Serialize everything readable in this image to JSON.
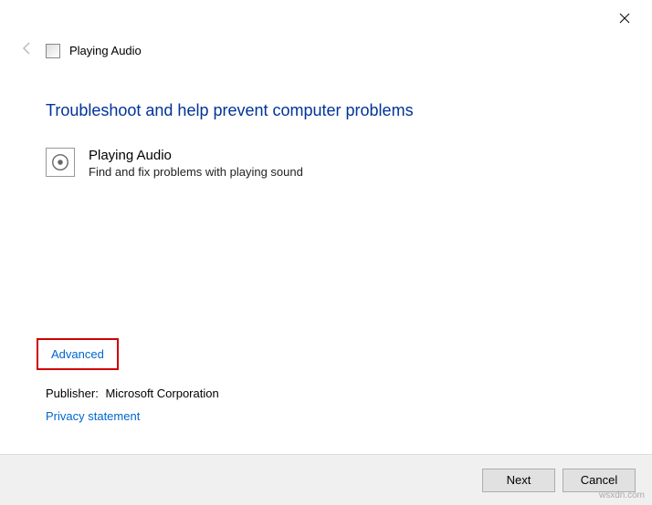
{
  "window": {
    "title": "Playing Audio"
  },
  "main": {
    "headline": "Troubleshoot and help prevent computer problems",
    "item": {
      "title": "Playing Audio",
      "description": "Find and fix problems with playing sound"
    }
  },
  "links": {
    "advanced": "Advanced",
    "privacy": "Privacy statement"
  },
  "publisher": {
    "label": "Publisher:",
    "value": "Microsoft Corporation"
  },
  "buttons": {
    "next": "Next",
    "cancel": "Cancel"
  },
  "watermark": "wsxdn.com"
}
